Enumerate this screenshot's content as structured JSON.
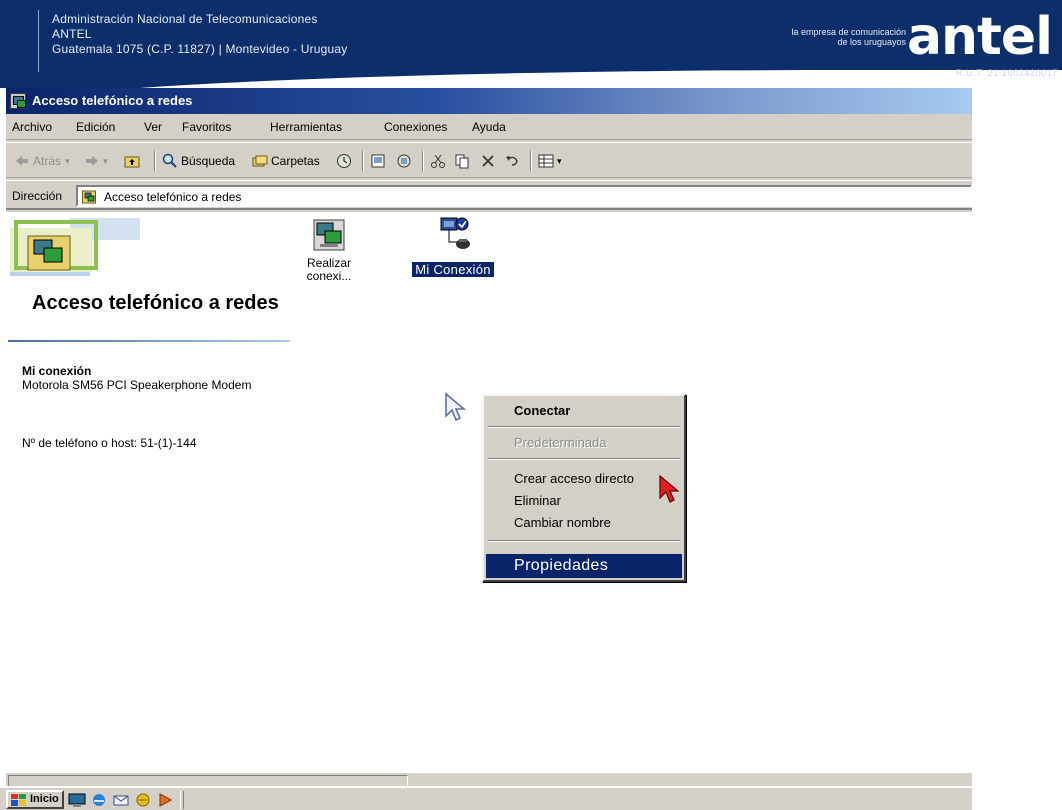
{
  "banner": {
    "org_lines": [
      "Administración Nacional de Telecomunicaciones",
      "ANTEL",
      "Guatemala 1075 (C.P. 11827) | Montevideo - Uruguay"
    ],
    "tagline_lines": [
      "la empresa de comunicación",
      "de los uruguayos"
    ],
    "logo": "antel",
    "rut": "R.U.T. 21 1003420017",
    "background_color": "#0c2f6b"
  },
  "window": {
    "title": "Acceso telefónico a redes",
    "menu": [
      "Archivo",
      "Edición",
      "Ver",
      "Favoritos",
      "Herramientas",
      "Conexiones",
      "Ayuda"
    ],
    "toolbar": {
      "back_label": "Atrás",
      "search_label": "Búsqueda",
      "folders_label": "Carpetas"
    },
    "address": {
      "label": "Dirección",
      "value": "Acceso telefónico a redes"
    }
  },
  "side_panel": {
    "title": "Acceso telefónico a redes",
    "connection_name": "Mi conexión",
    "modem": "Motorola SM56 PCI Speakerphone Modem",
    "phone": "Nº de teléfono o host: 51-(1)-144"
  },
  "icons": {
    "make_connection": "Realizar conexi...",
    "my_connection": "Mi Conexión"
  },
  "context_menu": {
    "items": [
      {
        "label": "Conectar",
        "state": "default"
      },
      {
        "label": "Predeterminada",
        "state": "disabled"
      },
      {
        "label": "Crear acceso directo",
        "state": "normal"
      },
      {
        "label": "Eliminar",
        "state": "normal"
      },
      {
        "label": "Cambiar nombre",
        "state": "normal"
      },
      {
        "label": "Propiedades",
        "state": "highlighted"
      }
    ]
  },
  "taskbar": {
    "start_label": "Inicio"
  },
  "colors": {
    "selection": "#0a246a",
    "window_face": "#d4d0c8",
    "title_gradient_start": "#0a246a",
    "title_gradient_end": "#a6caf0"
  }
}
